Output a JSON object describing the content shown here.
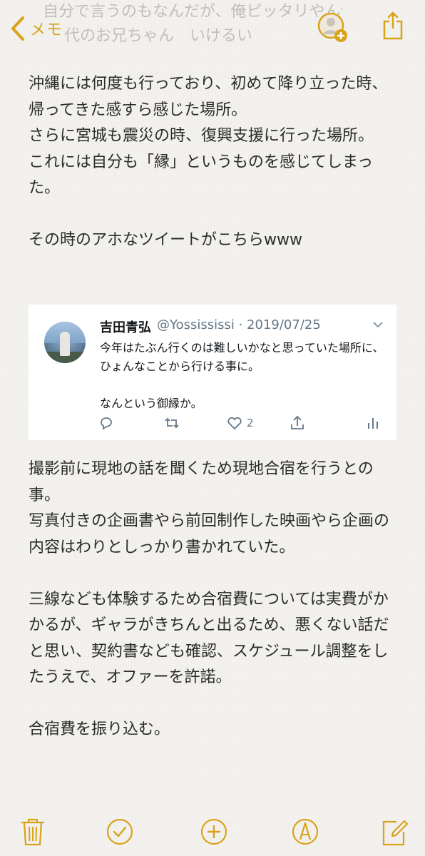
{
  "nav": {
    "back_label": "メモ",
    "ghost_lines": [
      "自分で言うのもなんだが、俺ピッタリやんw",
      "代のお兄ちゃん　いけるい"
    ]
  },
  "note": {
    "para1": "沖縄には何度も行っており、初めて降り立った時、帰ってきた感すら感じた場所。\nさらに宮城も震災の時、復興支援に行った場所。\nこれには自分も「縁」というものを感じてしまった。",
    "para2": "その時のアホなツイートがこちらwww",
    "para3": "撮影前に現地の話を聞くため現地合宿を行うとの事。\n写真付きの企画書やら前回制作した映画やら企画の内容はわりとしっかり書かれていた。",
    "para4": "三線なども体験するため合宿費については実費がかかるが、ギャラがきちんと出るため、悪くない話だと思い、契約書なども確認、スケジュール調整をしたうえで、オファーを許諾。",
    "para5": "合宿費を振り込む。"
  },
  "tweet": {
    "name": "吉田青弘",
    "handle_date": "@Yossississi · 2019/07/25",
    "text": "今年はたぶん行くのは難しいかなと思っていた場所に、ひょんなことから行ける事に。\n\nなんという御縁か。",
    "like_count": "2"
  },
  "colors": {
    "accent": "#d9a21b",
    "tweet_gray": "#657786",
    "background": "#f4f2ee"
  },
  "icons": {
    "back": "chevron-left-icon",
    "add_person": "add-person-icon",
    "share": "share-icon",
    "reply": "reply-icon",
    "retweet": "retweet-icon",
    "like": "heart-icon",
    "share_tweet": "share-tweet-icon",
    "analytics": "analytics-icon",
    "trash": "trash-icon",
    "checklist": "checklist-icon",
    "add": "add-icon",
    "markup": "markup-pen-icon",
    "compose": "compose-icon"
  }
}
